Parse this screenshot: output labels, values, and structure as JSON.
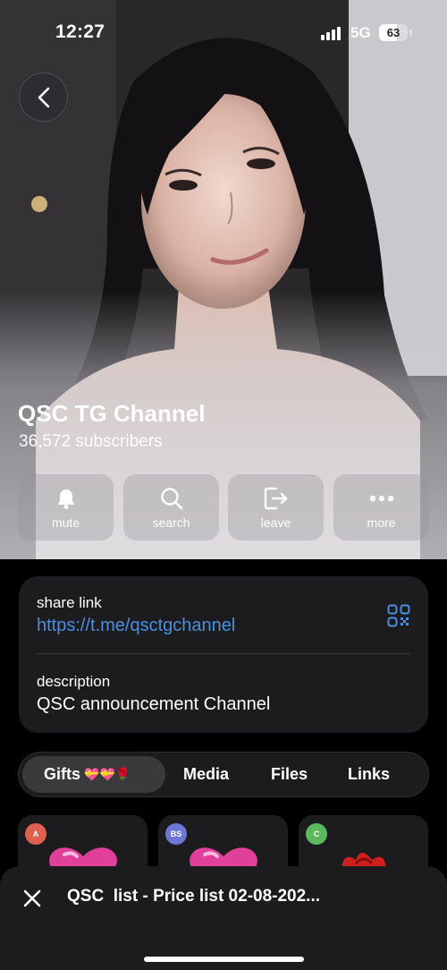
{
  "status_bar": {
    "time": "12:27",
    "network": "5G",
    "battery": "63"
  },
  "channel": {
    "title": "QSC TG Channel",
    "subscribers": "36,572 subscribers"
  },
  "actions": [
    {
      "label": "mute",
      "icon": "bell-icon"
    },
    {
      "label": "search",
      "icon": "search-icon"
    },
    {
      "label": "leave",
      "icon": "leave-icon"
    },
    {
      "label": "more",
      "icon": "more-dots-icon"
    }
  ],
  "info": {
    "share_label": "share link",
    "share_url": "https://t.me/qsctgchannel",
    "description_label": "description",
    "description": "QSC announcement Channel"
  },
  "tabs": [
    {
      "label": "Gifts",
      "emoji": "💝💝🌹",
      "active": true
    },
    {
      "label": "Media"
    },
    {
      "label": "Files"
    },
    {
      "label": "Links"
    }
  ],
  "gifts": [
    {
      "initials": "A",
      "color": "#e06050",
      "art": "heart-gift-icon"
    },
    {
      "initials": "BS",
      "color": "#6b78d8",
      "art": "heart-gift-icon"
    },
    {
      "initials": "C",
      "color": "#5cb85c",
      "art": "rose-gift-icon"
    }
  ],
  "player": {
    "title": "QSC  list - Price list 02-08-202..."
  },
  "colors": {
    "link": "#4a8fe0",
    "card": "#1c1c1e"
  }
}
